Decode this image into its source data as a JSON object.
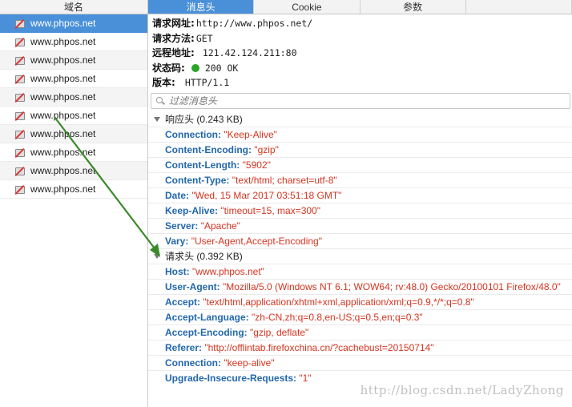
{
  "left": {
    "header": "域名",
    "rows": [
      "www.phpos.net",
      "www.phpos.net",
      "www.phpos.net",
      "www.phpos.net",
      "www.phpos.net",
      "www.phpos.net",
      "www.phpos.net",
      "www.phpos.net",
      "www.phpos.net",
      "www.phpos.net"
    ]
  },
  "tabs": [
    "消息头",
    "Cookie",
    "参数",
    ""
  ],
  "summary": {
    "url_label": "请求网址:",
    "url_value": "http://www.phpos.net/",
    "method_label": "请求方法:",
    "method_value": "GET",
    "remote_label": "远程地址:",
    "remote_value": "121.42.124.211:80",
    "status_label": "状态码:",
    "status_value": "200 OK",
    "version_label": "版本:",
    "version_value": "HTTP/1.1"
  },
  "filter": {
    "placeholder": "过滤消息头"
  },
  "response": {
    "title": "响应头",
    "size": "(0.243 KB)",
    "headers": [
      {
        "name": "Connection:",
        "value": "\"Keep-Alive\""
      },
      {
        "name": "Content-Encoding:",
        "value": "\"gzip\""
      },
      {
        "name": "Content-Length:",
        "value": "\"5902\""
      },
      {
        "name": "Content-Type:",
        "value": "\"text/html; charset=utf-8\""
      },
      {
        "name": "Date:",
        "value": "\"Wed, 15 Mar 2017 03:51:18 GMT\""
      },
      {
        "name": "Keep-Alive:",
        "value": "\"timeout=15, max=300\""
      },
      {
        "name": "Server:",
        "value": "\"Apache\""
      },
      {
        "name": "Vary:",
        "value": "\"User-Agent,Accept-Encoding\""
      }
    ]
  },
  "request": {
    "title": "请求头",
    "size": "(0.392 KB)",
    "headers": [
      {
        "name": "Host:",
        "value": "\"www.phpos.net\""
      },
      {
        "name": "User-Agent:",
        "value": "\"Mozilla/5.0 (Windows NT 6.1; WOW64; rv:48.0) Gecko/20100101 Firefox/48.0\""
      },
      {
        "name": "Accept:",
        "value": "\"text/html,application/xhtml+xml,application/xml;q=0.9,*/*;q=0.8\""
      },
      {
        "name": "Accept-Language:",
        "value": "\"zh-CN,zh;q=0.8,en-US;q=0.5,en;q=0.3\""
      },
      {
        "name": "Accept-Encoding:",
        "value": "\"gzip, deflate\""
      },
      {
        "name": "Referer:",
        "value": "\"http://offlintab.firefoxchina.cn/?cachebust=20150714\""
      },
      {
        "name": "Connection:",
        "value": "\"keep-alive\""
      },
      {
        "name": "Upgrade-Insecure-Requests:",
        "value": "\"1\""
      }
    ]
  },
  "watermark": "http://blog.csdn.net/LadyZhong",
  "colors": {
    "accent": "#4a90d9",
    "header_name": "#2267ad",
    "header_value": "#d4341f",
    "status_ok": "#2aa52a",
    "arrow": "#3a8a2a"
  }
}
